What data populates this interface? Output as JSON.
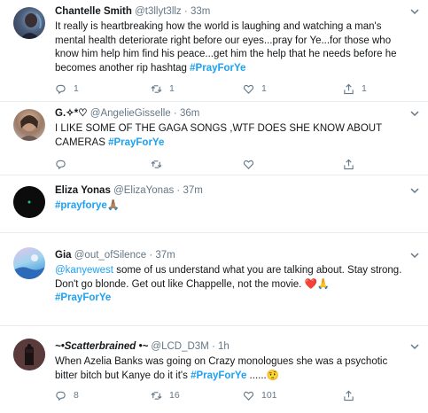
{
  "tweets": [
    {
      "name": "Chantelle Smith",
      "handle": "@t3llyt3llz",
      "sep": "·",
      "time": "33m",
      "text": "It really is heartbreaking how the world is laughing and watching a man's mental health deteriorate right before our eyes...pray for Ye...for those who know him help him find his peace...get him the help that he needs before he becomes another rip hashtag ",
      "hashtag": "#PrayForYe",
      "replies": "1",
      "retweets": "1",
      "likes": "1",
      "shares": "1"
    },
    {
      "name": "G.✧*♡",
      "handle": "@AngelieGisselle",
      "sep": "·",
      "time": "36m",
      "text": "I LIKE SOME OF THE GAGA SONGS ,WTF DOES SHE KNOW ABOUT CAMERAS ",
      "hashtag": "#PrayForYe",
      "replies": "",
      "retweets": "",
      "likes": "",
      "shares": ""
    },
    {
      "name": "Eliza Yonas",
      "handle": "@ElizaYonas",
      "sep": "·",
      "time": "37m",
      "hashtag": "#prayforye",
      "emoji": "🙏🏽"
    },
    {
      "name": "Gia",
      "handle": "@out_ofSilence",
      "sep": "·",
      "time": "37m",
      "mention": "@kanyewest",
      "text": " some of us understand what you are talking about. Stay strong. Don't go blonde. Get out like Chappelle, not the movie. ",
      "emoji": "❤️🙏",
      "hashtag": "#PrayForYe"
    },
    {
      "name": "~•Scatterbrained •~",
      "handle": "@LCD_D3M",
      "sep": "·",
      "time": "1h",
      "text": "When Azelia Banks was going on Crazy monologues she was a psychotic bitter bitch but Kanye do it it's ",
      "hashtag": "#PrayForYe",
      "trail": " ......",
      "emoji": "🤨",
      "replies": "8",
      "retweets": "16",
      "likes": "101",
      "shares": ""
    }
  ],
  "icons": {
    "reply": "reply-icon",
    "retweet": "retweet-icon",
    "like": "heart-icon",
    "share": "share-icon",
    "more": "chevron-down-icon"
  },
  "colors": {
    "accent": "#1da1f2",
    "muted": "#657786",
    "divider": "#e6ecf0"
  }
}
